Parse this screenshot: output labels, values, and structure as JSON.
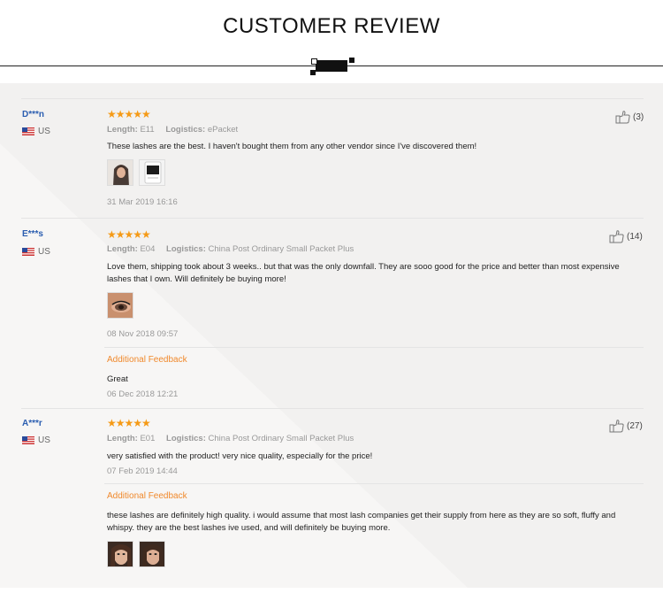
{
  "header": {
    "title": "CUSTOMER REVIEW"
  },
  "colors": {
    "accent_orange": "#f59a16",
    "feedback_orange": "#f0892c",
    "buyer_blue": "#2a5db0"
  },
  "reviews": [
    {
      "buyer": "D***n",
      "country": "US",
      "stars": "★★★★★",
      "length_label": "Length:",
      "length_value": "E11",
      "logistics_label": "Logistics:",
      "logistics_value": "ePacket",
      "text": "These lashes are the best. I haven't bought them from any other vendor since I've discovered them!",
      "date": "31 Mar 2019 16:16",
      "likes": "(3)"
    },
    {
      "buyer": "E***s",
      "country": "US",
      "stars": "★★★★★",
      "length_label": "Length:",
      "length_value": "E04",
      "logistics_label": "Logistics:",
      "logistics_value": "China Post Ordinary Small Packet Plus",
      "text": "Love them, shipping took about 3 weeks.. but that was the only downfall. They are sooo good for the price and better than most expensive lashes that I own. Will definitely be buying more!",
      "date": "08 Nov 2018 09:57",
      "likes": "(14)",
      "additional_label": "Additional Feedback",
      "additional_text": "Great",
      "additional_date": "06 Dec 2018 12:21"
    },
    {
      "buyer": "A***r",
      "country": "US",
      "stars": "★★★★★",
      "length_label": "Length:",
      "length_value": "E01",
      "logistics_label": "Logistics:",
      "logistics_value": "China Post Ordinary Small Packet Plus",
      "text": "very satisfied with the product! very nice quality, especially for the price!",
      "date": "07 Feb 2019 14:44",
      "likes": "(27)",
      "additional_label": "Additional Feedback",
      "additional_text": "these lashes are definitely high quality. i would assume that most lash companies get their supply from here as they are so soft, fluffy and whispy. they are the best lashes ive used, and will definitely be buying more."
    }
  ]
}
